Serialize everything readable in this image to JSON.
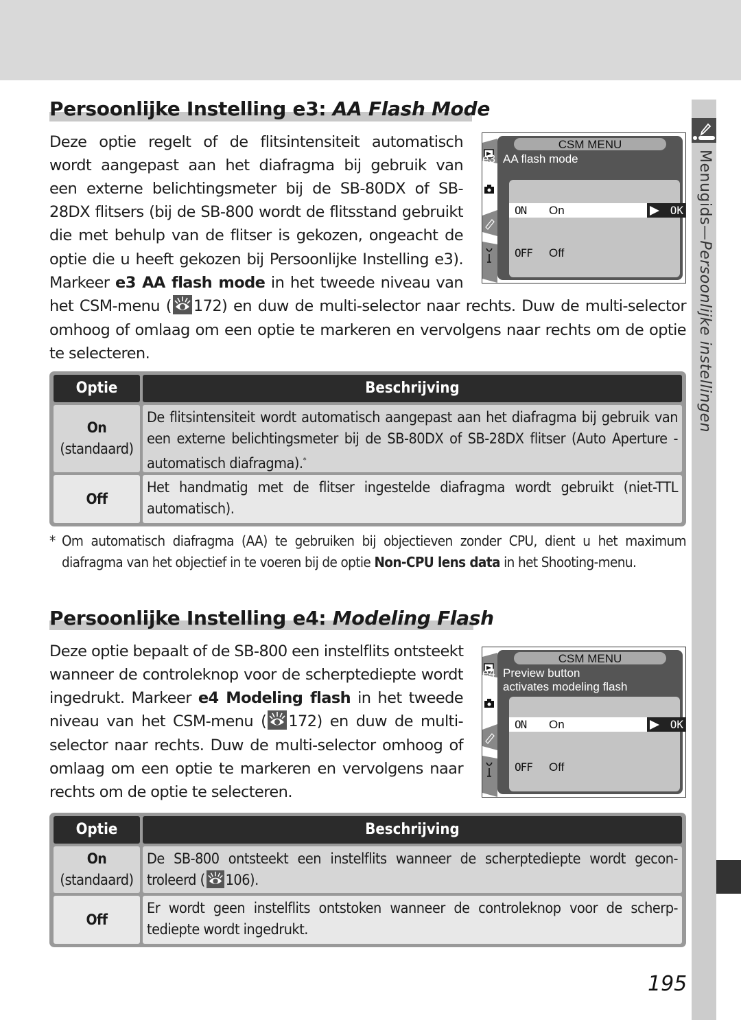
{
  "side_tab": {
    "label_regular": "Menugids—",
    "label_italic": "Persoonlijke instellingen",
    "icon": "pencil-icon"
  },
  "section_e3": {
    "heading_prefix": "Persoonlijke Instelling e3: ",
    "heading_italic": "AA Flash Mode",
    "para_lines": [
      "Deze optie regelt of de flitsintensiteit automatisch",
      "wordt aangepast aan het diafragma bij gebruik van",
      "een externe belichtingsmeter bij de SB-80DX of SB-",
      "28DX flitsers (bij de SB-800 wordt de flitsstand gebruikt",
      "die met behulp van de flitser is gekozen, ongeacht de",
      "optie die u heeft gekozen bij Persoonlijke Instelling e3)."
    ],
    "line7_pre": "Markeer ",
    "line7_bold": "e3 AA flash mode",
    "line7_post": " in het tweede niveau van",
    "line8_pre": "het CSM-menu (",
    "line8_ref": "172",
    "line8_post": ") en duw de multi-selector naar rechts. Duw de multi-selector",
    "line9": "omhoog of omlaag om een optie te markeren en vervolgens naar rechts om de optie",
    "line10": "te selecteren.",
    "screen": {
      "title": "CSM MENU",
      "item_code": "e3",
      "item_lines": [
        "AA flash mode"
      ],
      "options": [
        {
          "code": "ON",
          "label": "On",
          "selected": true
        },
        {
          "code": "OFF",
          "label": "Off",
          "selected": false
        }
      ],
      "ok_label": "OK"
    },
    "table": {
      "headers": [
        "Optie",
        "Beschrijving"
      ],
      "rows": [
        {
          "option": "On",
          "default": "(standaard)",
          "desc": "De flitsintensiteit wordt automatisch aangepast aan het diafragma bij gebruik van een externe belichtingsmeter bij de SB-80DX of SB-28DX flitser (Auto Aperture - automatisch diafragma).",
          "footnote_mark": "*"
        },
        {
          "option": "Off",
          "default": "",
          "desc": "Het handmatig met de flitser ingestelde diafragma wordt gebruikt (niet-TTL automatisch)."
        }
      ]
    },
    "footnote": {
      "mark": "*",
      "pre": "Om automatisch diafragma (AA) te gebruiken bij objectieven zonder CPU, dient u het maximum diafragma van het objectief in te voeren bij de optie ",
      "bold": "Non-CPU lens data",
      "post": " in het Shooting-menu."
    }
  },
  "section_e4": {
    "heading_prefix": "Persoonlijke Instelling e4: ",
    "heading_italic": "Modeling Flash",
    "line1": "Deze optie bepaalt of de SB-800 een instelflits ontsteekt",
    "line2": "wanneer de controleknop voor de scherptediepte wordt",
    "line3_pre": "ingedrukt. Markeer ",
    "line3_bold": "e4 Modeling flash",
    "line3_post": " in het tweede",
    "line4_pre": "niveau van het CSM-menu (",
    "line4_ref": "172",
    "line4_post": ") en duw de multi-",
    "line5": "selector naar rechts. Duw de multi-selector omhoog of",
    "line6": "omlaag om een optie te markeren en vervolgens naar",
    "line7": "rechts om de optie te selecteren.",
    "screen": {
      "title": "CSM MENU",
      "item_code": "e4",
      "item_lines": [
        "Preview button",
        "activates modeling flash"
      ],
      "options": [
        {
          "code": "ON",
          "label": "On",
          "selected": true
        },
        {
          "code": "OFF",
          "label": "Off",
          "selected": false
        }
      ],
      "ok_label": "OK"
    },
    "table": {
      "headers": [
        "Optie",
        "Beschrijving"
      ],
      "rows": [
        {
          "option": "On",
          "default": "(standaard)",
          "desc_pre": "De SB-800 ontsteekt een instelflits wanneer de scherptediepte wordt gecon-troleerd (",
          "desc_ref": "106",
          "desc_post": ")."
        },
        {
          "option": "Off",
          "default": "",
          "desc": "Er wordt geen instelflits ontstoken wanneer de controleknop voor de scherp-tediepte wordt ingedrukt."
        }
      ]
    }
  },
  "page_number": "195"
}
